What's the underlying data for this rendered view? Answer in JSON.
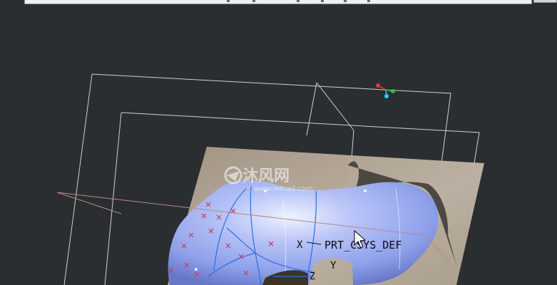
{
  "app": {
    "canvas_bg": "#2b2e30"
  },
  "watermark": {
    "brand": "沐风网",
    "site": "www.mfcad.com"
  },
  "model": {
    "csys_label": "PRT_CSYS_DEF",
    "axis_x_label": "X",
    "axis_y_label": "Y",
    "axis_z_label": "Z",
    "surface_color": "#a9b8f3",
    "sketch_plane_color": "#b9ad9e",
    "datum_plane_color": "#c8c8c8",
    "datum_plane_selected_color": "#b58a8a",
    "curve_color": "#2a6fe0",
    "point_marker_color": "#d23a5a"
  },
  "triad": {
    "x_color": "#e23a2a",
    "y_color": "#3ab54a",
    "z_color": "#2ad0ff"
  }
}
